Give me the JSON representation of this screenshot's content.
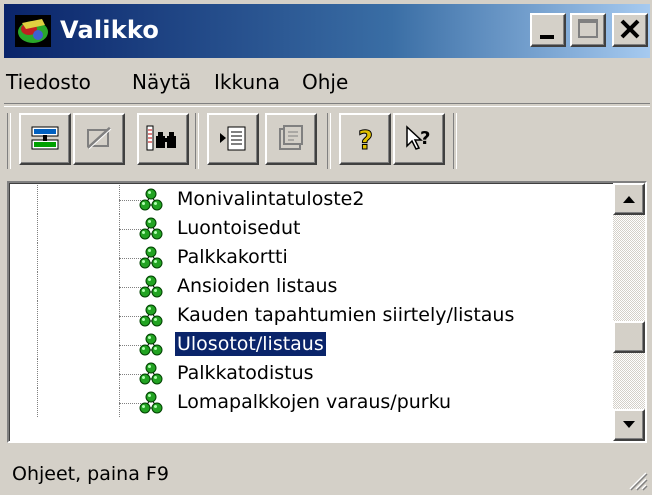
{
  "window": {
    "title": "Valikko",
    "controls": {
      "minimize": "_",
      "maximize": "□",
      "close": "✕"
    }
  },
  "menu": {
    "items": [
      "Tiedosto",
      "Näytä",
      "Ikkuna",
      "Ohje"
    ]
  },
  "toolbar": {
    "buttons": [
      {
        "icon": "tree-view-icon",
        "enabled": true
      },
      {
        "icon": "disabled-view-icon",
        "enabled": false
      },
      {
        "icon": "find-icon",
        "enabled": true
      },
      {
        "icon": "indent-list-icon",
        "enabled": true
      },
      {
        "icon": "properties-icon",
        "enabled": false
      },
      {
        "icon": "help-question-icon",
        "enabled": true
      },
      {
        "icon": "context-help-icon",
        "enabled": true
      }
    ]
  },
  "tree": {
    "items": [
      {
        "label": "Monivalintatuloste2",
        "selected": false
      },
      {
        "label": "Luontoisedut",
        "selected": false
      },
      {
        "label": "Palkkakortti",
        "selected": false
      },
      {
        "label": "Ansioiden listaus",
        "selected": false
      },
      {
        "label": "Kauden tapahtumien siirtely/listaus",
        "selected": false
      },
      {
        "label": "Ulosotot/listaus",
        "selected": true
      },
      {
        "label": "Palkkatodistus",
        "selected": false
      },
      {
        "label": "Lomapalkkojen varaus/purku",
        "selected": false
      }
    ],
    "node_icon": "green-molecule-icon",
    "colors": {
      "selection": "#0a246a",
      "node": "#22a322"
    }
  },
  "status": {
    "text": "Ohjeet, paina F9"
  },
  "colors": {
    "titlebar_start": "#0a246a",
    "titlebar_end": "#a6caf0",
    "face": "#d4d0c8"
  }
}
